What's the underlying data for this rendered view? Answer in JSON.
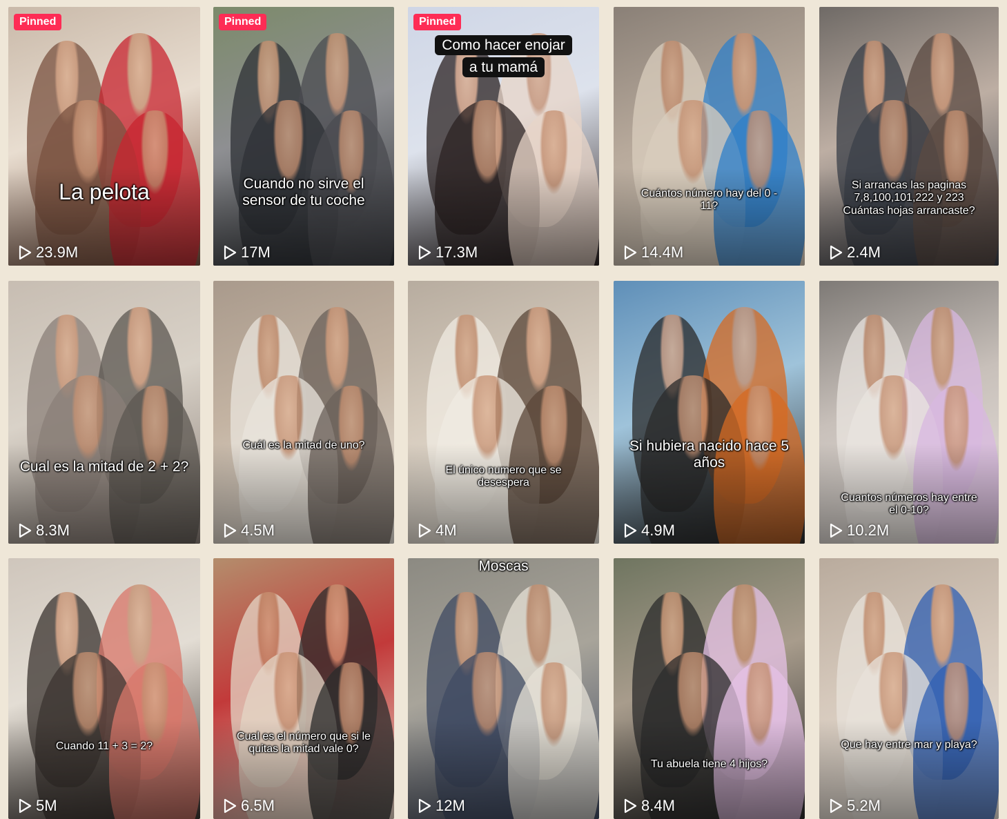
{
  "tiles": [
    {
      "pinned": "Pinned",
      "caption": "La pelota",
      "views": "23.9M",
      "style": "big",
      "capTop": 250,
      "palette": [
        "#c9b9a9",
        "#e8ddd0",
        "#c8242f",
        "#7a5240"
      ]
    },
    {
      "pinned": "Pinned",
      "caption": "Cuando no sirve el sensor de tu coche",
      "views": "17M",
      "style": "mid",
      "capTop": 245,
      "palette": [
        "#7c8a6a",
        "#8e8f92",
        "#4a4b50",
        "#2e3136"
      ]
    },
    {
      "pinned": "Pinned",
      "caption": "Como hacer enojar a tu mamá",
      "views": "17.3M",
      "style": "boxed",
      "capTop": 40,
      "palette": [
        "#cfd6e6",
        "#dde2ec",
        "#e8d5c8",
        "#2b2222"
      ]
    },
    {
      "pinned": "",
      "caption": "Cuántos número hay del 0 - 11?",
      "views": "14.4M",
      "style": "small",
      "capTop": 262,
      "palette": [
        "#8a8077",
        "#b7a99b",
        "#2e7fc9",
        "#d9cdbd"
      ]
    },
    {
      "pinned": "",
      "caption": "Si arrancas las paginas 7,8,100,101,222 y 223 Cuántas hojas arrancaste?",
      "views": "2.4M",
      "style": "small",
      "capTop": 250,
      "palette": [
        "#6f6a66",
        "#bdaea3",
        "#5b4a42",
        "#3a3f48"
      ]
    },
    {
      "pinned": "",
      "caption": "Cual es la mitad de 2 + 2?",
      "views": "8.3M",
      "style": "mid",
      "capTop": 258,
      "palette": [
        "#c7bdb2",
        "#d9d2c8",
        "#5c5751",
        "#8a7f78"
      ]
    },
    {
      "pinned": "",
      "caption": "Cuál es la mitad de uno?",
      "views": "4.5M",
      "style": "small",
      "capTop": 230,
      "palette": [
        "#a99a8c",
        "#c4b4a3",
        "#6a6059",
        "#e9e4dc"
      ]
    },
    {
      "pinned": "",
      "caption": "El único numero que se desespera",
      "views": "4M",
      "style": "small",
      "capTop": 266,
      "palette": [
        "#b7ac9f",
        "#d6cbbd",
        "#5a4638",
        "#f0ebe2"
      ]
    },
    {
      "pinned": "",
      "caption": "Si hubiera nacido hace 5 años",
      "views": "4.9M",
      "style": "mid",
      "capTop": 228,
      "palette": [
        "#5f8fb8",
        "#9fc3da",
        "#d66a22",
        "#2a2a2a"
      ]
    },
    {
      "pinned": "",
      "caption": "Cuantos números hay entre el 0-10?",
      "views": "10.2M",
      "style": "small",
      "capTop": 306,
      "palette": [
        "#7e7a76",
        "#c8c0ba",
        "#d8b8e0",
        "#e9e4df"
      ]
    },
    {
      "pinned": "",
      "caption": "Cuando 11 + 3 = 2?",
      "views": "5M",
      "style": "small",
      "capTop": 264,
      "palette": [
        "#cfc6bc",
        "#e3ddd4",
        "#d9776a",
        "#3b3430"
      ]
    },
    {
      "pinned": "",
      "caption": "Cual es el número que si le quitas la mitad vale 0?",
      "views": "6.5M",
      "style": "small",
      "capTop": 250,
      "palette": [
        "#b48d6c",
        "#c23a3a",
        "#2b2b2b",
        "#e4d6c6"
      ]
    },
    {
      "pinned": "",
      "caption": "Moscas",
      "views": "12M",
      "style": "mid",
      "capTop": 0,
      "palette": [
        "#8c8a82",
        "#a8a49a",
        "#e6e1d6",
        "#3f4a62"
      ]
    },
    {
      "pinned": "",
      "caption": "Tu abuela tiene 4 hijos?",
      "views": "8.4M",
      "style": "small",
      "capTop": 290,
      "palette": [
        "#6f7560",
        "#a89c8c",
        "#e6c2e6",
        "#2b2b2b"
      ]
    },
    {
      "pinned": "",
      "caption": "Que hay entre mar y playa?",
      "views": "5.2M",
      "style": "small",
      "capTop": 262,
      "palette": [
        "#b9ab9d",
        "#d6c9bc",
        "#2f5fb3",
        "#e8e2da"
      ]
    }
  ]
}
